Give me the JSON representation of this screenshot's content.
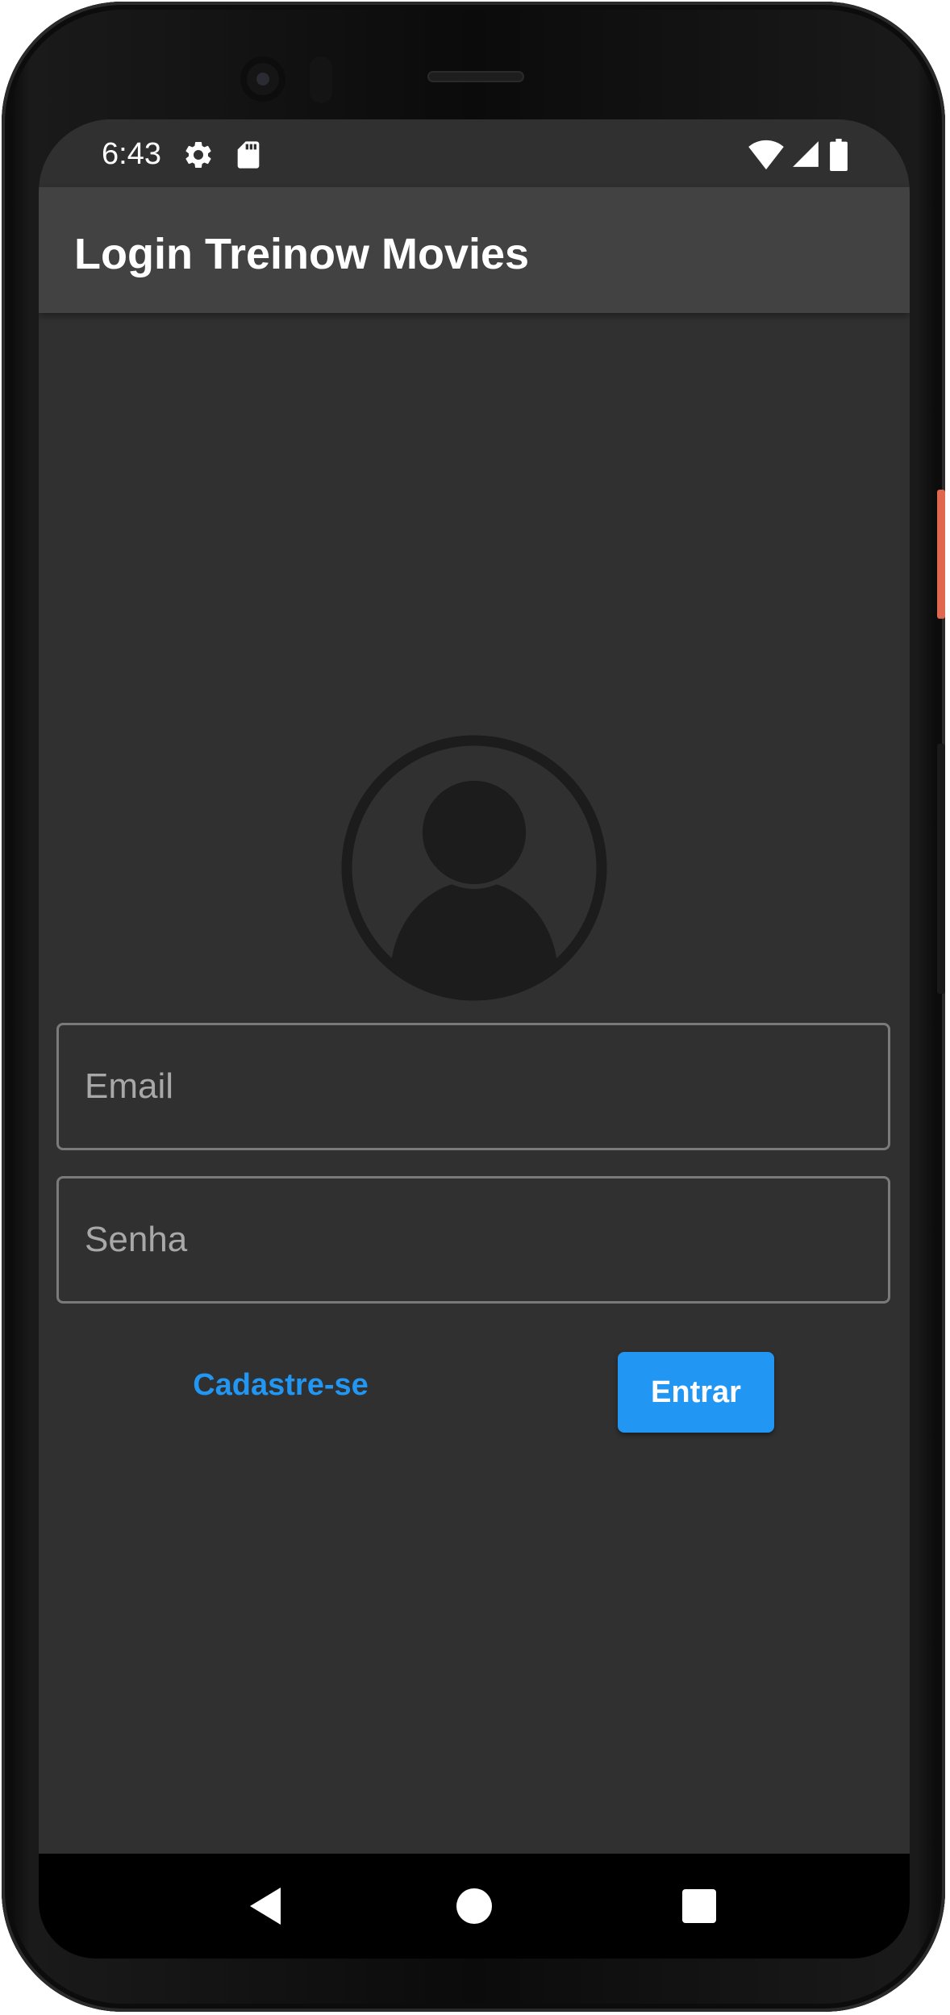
{
  "status_bar": {
    "time": "6:43",
    "left_icons": [
      "gear-icon",
      "sd-card-icon"
    ],
    "right_icons": [
      "wifi-icon",
      "signal-icon",
      "battery-icon"
    ]
  },
  "app_bar": {
    "title": "Login Treinow Movies"
  },
  "avatar": {
    "icon": "account-circle-icon"
  },
  "form": {
    "email": {
      "placeholder": "Email",
      "value": ""
    },
    "password": {
      "placeholder": "Senha",
      "value": ""
    },
    "register_label": "Cadastre-se",
    "submit_label": "Entrar"
  },
  "nav_bar": {
    "buttons": [
      "back-icon",
      "home-icon",
      "recents-icon"
    ]
  },
  "colors": {
    "background": "#303030",
    "app_bar": "#424242",
    "accent": "#2196f3",
    "field_border": "#7a7a7a",
    "avatar": "#1c1c1c"
  }
}
